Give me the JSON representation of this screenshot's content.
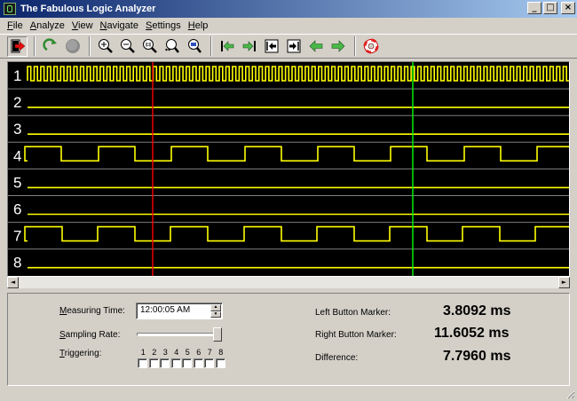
{
  "window": {
    "title": "The Fabulous Logic Analyzer",
    "minimize": "_",
    "maximize": "□",
    "close": "×"
  },
  "menu": [
    {
      "key": "F",
      "rest": "ile"
    },
    {
      "key": "A",
      "rest": "nalyze"
    },
    {
      "key": "V",
      "rest": "iew"
    },
    {
      "key": "N",
      "rest": "avigate"
    },
    {
      "key": "S",
      "rest": "ettings"
    },
    {
      "key": "H",
      "rest": "elp"
    }
  ],
  "toolbar": {
    "icons": [
      "exit-icon",
      "refresh-icon",
      "stop-icon",
      "zoom-in-icon",
      "zoom-out-icon",
      "zoom-1-1-icon",
      "zoom-fit-icon",
      "zoom-area-icon",
      "go-start-icon",
      "go-end-icon",
      "go-left-marker-icon",
      "go-right-marker-icon",
      "arrow-left-icon",
      "arrow-right-icon",
      "help-lifebuoy-icon"
    ]
  },
  "channels": [
    "1",
    "2",
    "3",
    "4",
    "5",
    "6",
    "7",
    "8"
  ],
  "colors": {
    "trace": "#ffff00",
    "left_marker": "#ff0000",
    "right_marker": "#00ff00",
    "label": "#ffffff",
    "bg": "#000000",
    "separator": "#7f7f7f"
  },
  "scroll": {
    "left": "◄",
    "right": "►"
  },
  "panel": {
    "measuring_time": {
      "key": "M",
      "rest": "easuring Time:",
      "value": "12:00:05 AM"
    },
    "sampling_rate": {
      "key": "S",
      "rest": "ampling Rate:",
      "level": 1.0
    },
    "triggering": {
      "key": "T",
      "rest": "riggering:",
      "numbers": [
        "1",
        "2",
        "3",
        "4",
        "5",
        "6",
        "7",
        "8"
      ]
    },
    "left_marker": {
      "label": "Left Button Marker:",
      "value": "3.8092 ms"
    },
    "right_marker": {
      "label": "Right Button Marker:",
      "value": "11.6052 ms"
    },
    "difference": {
      "label": "Difference:",
      "value": "7.7960 ms"
    }
  }
}
